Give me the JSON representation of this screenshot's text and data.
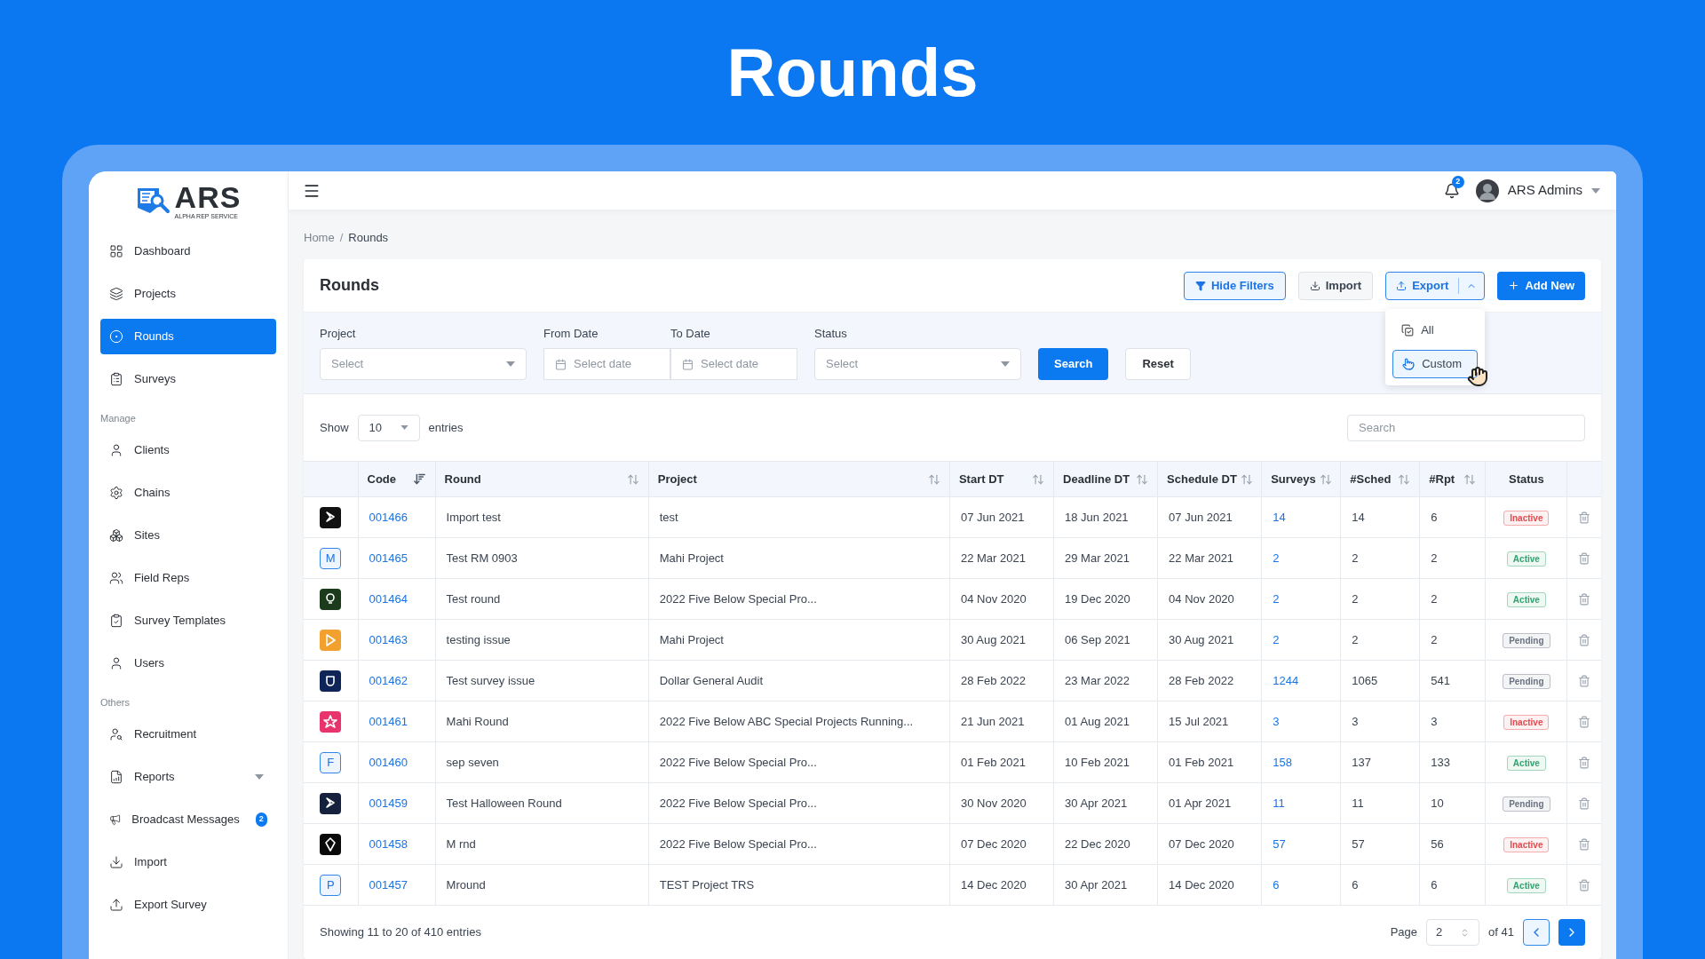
{
  "page_title": "Rounds",
  "logo": {
    "name": "ARS",
    "tagline": "ALPHA REP SERVICE"
  },
  "sidebar": {
    "sections": [
      {
        "items": [
          {
            "label": "Dashboard",
            "kind": "link",
            "selected": false
          },
          {
            "label": "Projects",
            "kind": "link",
            "selected": false
          },
          {
            "label": "Rounds",
            "kind": "link",
            "selected": true
          },
          {
            "label": "Surveys",
            "kind": "link",
            "selected": false
          }
        ]
      },
      {
        "heading": "Manage",
        "items": [
          {
            "label": "Clients",
            "kind": "link",
            "selected": false
          },
          {
            "label": "Chains",
            "kind": "link",
            "selected": false
          },
          {
            "label": "Sites",
            "kind": "link",
            "selected": false
          },
          {
            "label": "Field Reps",
            "kind": "link",
            "selected": false
          },
          {
            "label": "Survey Templates",
            "kind": "link",
            "selected": false
          },
          {
            "label": "Users",
            "kind": "link",
            "selected": false
          }
        ]
      },
      {
        "heading": "Others",
        "items": [
          {
            "label": "Recruitment",
            "kind": "link",
            "selected": false
          },
          {
            "label": "Reports",
            "kind": "group",
            "selected": false
          },
          {
            "label": "Broadcast Messages",
            "kind": "link",
            "selected": false,
            "badge": "2"
          },
          {
            "label": "Import",
            "kind": "link",
            "selected": false
          },
          {
            "label": "Export Survey",
            "kind": "link",
            "selected": false
          }
        ]
      }
    ]
  },
  "header": {
    "notifications": "2",
    "user": "ARS Admins"
  },
  "breadcrumb": {
    "separator": "/",
    "items": [
      "Home",
      "Rounds"
    ]
  },
  "card": {
    "title": "Rounds",
    "actions": [
      {
        "label": "Hide Filters",
        "kind": "outline"
      },
      {
        "label": "Import",
        "kind": "plain"
      },
      {
        "label": "Export",
        "kind": "split",
        "expanded": true,
        "menu": [
          {
            "label": "All",
            "selected": false
          },
          {
            "label": "Custom",
            "selected": true
          }
        ]
      },
      {
        "label": "Add New",
        "kind": "primary"
      }
    ],
    "filters": [
      {
        "label": "Project",
        "kind": "select",
        "placeholder": "Select"
      },
      {
        "label": "From Date",
        "kind": "date",
        "placeholder": "Select date"
      },
      {
        "label": "To Date",
        "kind": "date",
        "placeholder": "Select date"
      },
      {
        "label": "Status",
        "kind": "select",
        "placeholder": "Select"
      }
    ],
    "filter_buttons": [
      {
        "label": "Search",
        "kind": "primary"
      },
      {
        "label": "Reset",
        "kind": "plain"
      }
    ]
  },
  "table": {
    "show_label": "Show",
    "page_size": "10",
    "entries_label": "entries",
    "search_placeholder": "Search",
    "columns": [
      {
        "label": "Code",
        "sortable": true,
        "sorted": true
      },
      {
        "label": "Round",
        "sortable": true,
        "sorted": false
      },
      {
        "label": "Project",
        "sortable": true,
        "sorted": false
      },
      {
        "label": "Start DT",
        "sortable": true,
        "sorted": false
      },
      {
        "label": "Deadline DT",
        "sortable": true,
        "sorted": false
      },
      {
        "label": "Schedule DT",
        "sortable": true,
        "sorted": false
      },
      {
        "label": "Surveys",
        "sortable": true,
        "sorted": false
      },
      {
        "label": "#Sched",
        "sortable": true,
        "sorted": false
      },
      {
        "label": "#Rpt",
        "sortable": true,
        "sorted": false
      },
      {
        "label": "Status",
        "sortable": false,
        "sorted": false
      }
    ],
    "rows": [
      {
        "avatar": {
          "kind": "logo",
          "color": "#111111"
        },
        "cells": [
          "001466",
          "Import test",
          "test",
          "07 Jun 2021",
          "18 Jun 2021",
          "07 Jun 2021",
          "14",
          "14",
          "6"
        ],
        "status": {
          "label": "Inactive",
          "color": "#e5484d"
        }
      },
      {
        "avatar": {
          "kind": "letter",
          "letter": "M"
        },
        "cells": [
          "001465",
          "Test RM 0903",
          "Mahi Project",
          "22 Mar 2021",
          "29 Mar 2021",
          "22 Mar 2021",
          "2",
          "2",
          "2"
        ],
        "status": {
          "label": "Active",
          "color": "#30a46c"
        }
      },
      {
        "avatar": {
          "kind": "logo",
          "color": "#1c3a1c"
        },
        "cells": [
          "001464",
          "Test round",
          "2022 Five Below Special Pro...",
          "04 Nov 2020",
          "19 Dec 2020",
          "04 Nov 2020",
          "2",
          "2",
          "2"
        ],
        "status": {
          "label": "Active",
          "color": "#30a46c"
        }
      },
      {
        "avatar": {
          "kind": "logo",
          "color": "#f2a12e"
        },
        "cells": [
          "001463",
          "testing issue",
          "Mahi Project",
          "30 Aug 2021",
          "06 Sep 2021",
          "30 Aug 2021",
          "2",
          "2",
          "2"
        ],
        "status": {
          "label": "Pending",
          "color": "#6b7280"
        }
      },
      {
        "avatar": {
          "kind": "logo",
          "color": "#0f2557"
        },
        "cells": [
          "001462",
          "Test survey issue",
          "Dollar General Audit",
          "28 Feb 2022",
          "23 Mar 2022",
          "28 Feb 2022",
          "1244",
          "1065",
          "541"
        ],
        "status": {
          "label": "Pending",
          "color": "#6b7280"
        }
      },
      {
        "avatar": {
          "kind": "logo",
          "color": "#e8336d"
        },
        "cells": [
          "001461",
          "Mahi Round",
          "2022 Five Below ABC Special Projects Running...",
          "21 Jun 2021",
          "01 Aug 2021",
          "15 Jul 2021",
          "3",
          "3",
          "3"
        ],
        "status": {
          "label": "Inactive",
          "color": "#e5484d"
        }
      },
      {
        "avatar": {
          "kind": "letter",
          "letter": "F"
        },
        "cells": [
          "001460",
          "sep seven",
          "2022 Five Below Special Pro...",
          "01 Feb 2021",
          "10 Feb 2021",
          "01 Feb 2021",
          "158",
          "137",
          "133"
        ],
        "status": {
          "label": "Active",
          "color": "#30a46c"
        }
      },
      {
        "avatar": {
          "kind": "logo",
          "color": "#15203d"
        },
        "cells": [
          "001459",
          "Test Halloween Round",
          "2022 Five Below Special Pro...",
          "30 Nov 2020",
          "30 Apr 2021",
          "01 Apr 2021",
          "11",
          "11",
          "10"
        ],
        "status": {
          "label": "Pending",
          "color": "#6b7280"
        }
      },
      {
        "avatar": {
          "kind": "logo",
          "color": "#0a0a0a"
        },
        "cells": [
          "001458",
          "M rnd",
          "2022 Five Below Special Pro...",
          "07 Dec 2020",
          "22 Dec 2020",
          "07 Dec 2020",
          "57",
          "57",
          "56"
        ],
        "status": {
          "label": "Inactive",
          "color": "#e5484d"
        }
      },
      {
        "avatar": {
          "kind": "letter",
          "letter": "P"
        },
        "cells": [
          "001457",
          "Mround",
          "TEST Project TRS",
          "14 Dec 2020",
          "30 Apr 2021",
          "14 Dec 2020",
          "6",
          "6",
          "6"
        ],
        "status": {
          "label": "Active",
          "color": "#30a46c"
        }
      }
    ]
  },
  "footer": {
    "summary": "Showing 11 to 20 of 410 entries",
    "page_label": "Page",
    "page": "2",
    "of_label": "of 41"
  }
}
